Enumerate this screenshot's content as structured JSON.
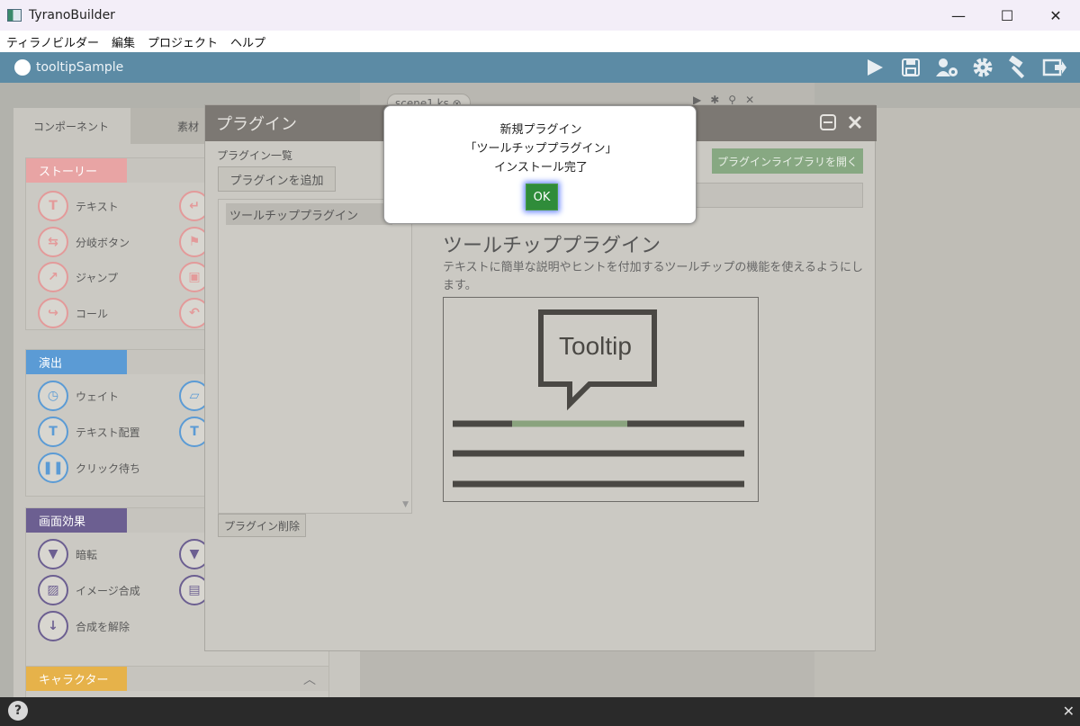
{
  "window": {
    "title": "TyranoBuilder",
    "minimize": "—",
    "maximize": "☐",
    "close": "✕"
  },
  "menu": [
    "ティラノビルダー",
    "編集",
    "プロジェクト",
    "ヘルプ"
  ],
  "header": {
    "project_name": "tooltipSample"
  },
  "left_panel": {
    "tabs": [
      "コンポーネント",
      "素材"
    ],
    "sections": [
      {
        "label": "ストーリー",
        "color": "#e8a4a4",
        "items": [
          "テキスト",
          "分岐ボタン",
          "ジャンプ",
          "コール"
        ]
      },
      {
        "label": "演出",
        "color": "#5b9bd5",
        "items": [
          "ウェイト",
          "テキスト配置",
          "クリック待ち"
        ]
      },
      {
        "label": "画面効果",
        "color": "#6c5f91",
        "items": [
          "暗転",
          "イメージ合成",
          "合成を解除"
        ]
      },
      {
        "label": "キャラクター",
        "color": "#e6b24a"
      }
    ]
  },
  "scene": {
    "tab_label": "scene1.ks ⊗"
  },
  "plugin_dialog": {
    "title": "プラグイン",
    "list_label": "プラグイン一覧",
    "add_button": "プラグインを追加",
    "delete_button": "プラグイン削除",
    "library_button": "プラグインライブラリを開く",
    "plugins": [
      "ツールチッププラグイン"
    ],
    "detail": {
      "name": "ツールチッププラグイン",
      "description": "テキストに簡単な説明やヒントを付加するツールチップの機能を使えるようにします。",
      "image_text": "Tooltip"
    }
  },
  "alert": {
    "lines": [
      "新規プラグイン",
      "「ツールチッププラグイン」",
      "インストール完了"
    ],
    "ok_label": "OK"
  },
  "statusbar": {
    "help": "?",
    "close": "✕"
  }
}
